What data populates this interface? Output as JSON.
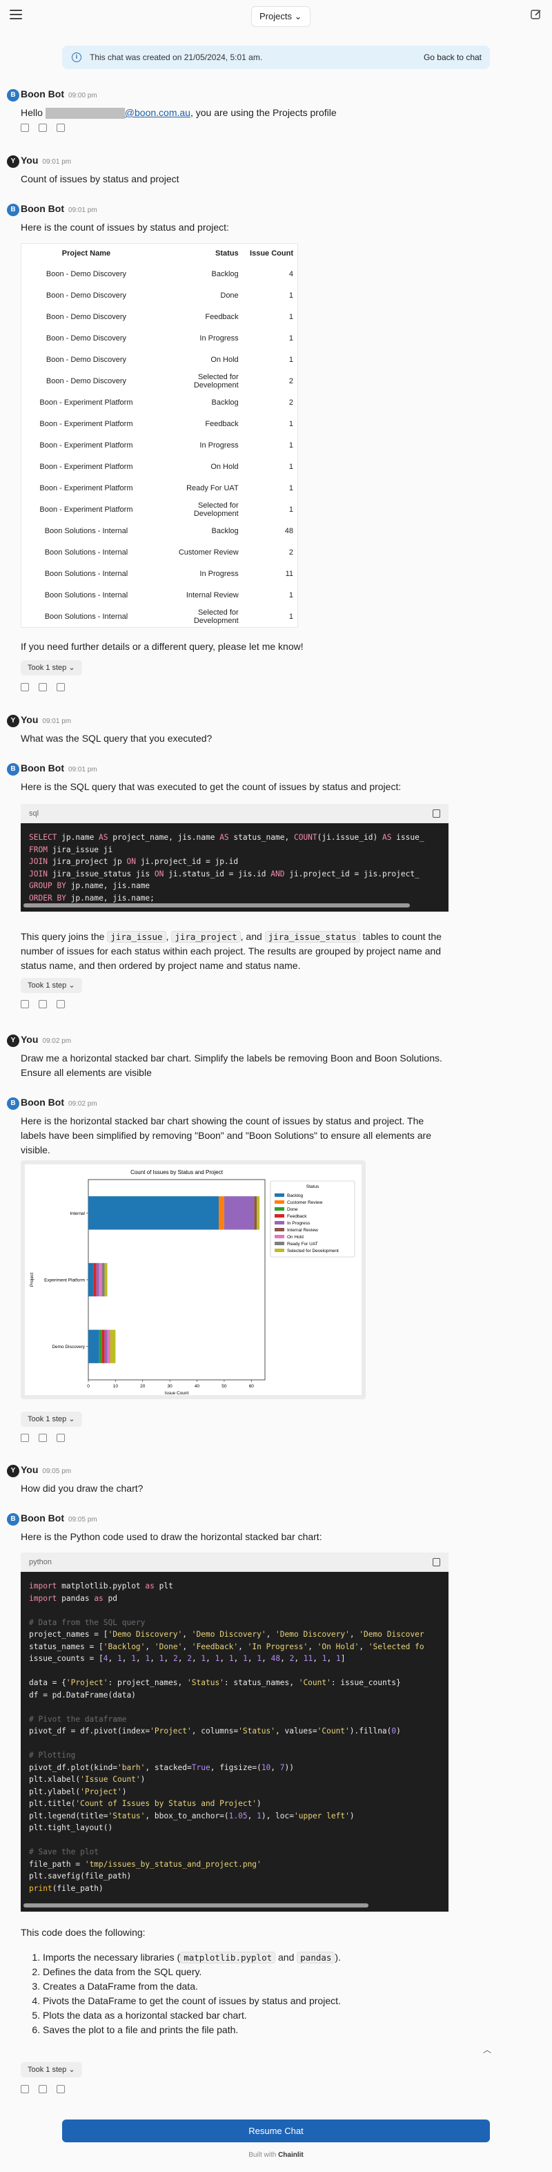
{
  "header": {
    "profile_label": "Projects",
    "profile_chevron": "⌄"
  },
  "banner": {
    "text": "This chat was created on 21/05/2024, 5:01 am.",
    "back": "Go back to chat"
  },
  "bot_name": "Boon Bot",
  "user_name": "You",
  "bot_avatar": "B",
  "user_avatar": "Y",
  "messages": {
    "m1": {
      "time": "09:00 pm",
      "hello": "Hello ",
      "email": "@boon.com.au",
      "tail": ", you are using the Projects profile"
    },
    "m2": {
      "time": "09:01 pm",
      "text": "Count of issues by status and project"
    },
    "m3": {
      "time": "09:01 pm",
      "text": "Here is the count of issues by status and project:",
      "followup": "If you need further details or a different query, please let me know!",
      "step": "Took 1 step"
    },
    "m4": {
      "time": "09:01 pm",
      "text": "What was the SQL query that you executed?"
    },
    "m5": {
      "time": "09:01 pm",
      "text": "Here is the SQL query that was executed to get the count of issues by status and project:",
      "lang": "sql",
      "explain": {
        "p1": "This query joins the ",
        "c1": "jira_issue",
        "p2": ", ",
        "c2": "jira_project",
        "p3": ", and ",
        "c3": "jira_issue_status",
        "p4": " tables to count the number of issues for each status within each project. The results are grouped by project name and status name, and then ordered by project name and status name."
      },
      "step": "Took 1 step"
    },
    "m6": {
      "time": "09:02 pm",
      "text": "Draw me a horizontal stacked bar chart. Simplify the labels be removing Boon and Boon Solutions. Ensure all elements are visible"
    },
    "m7": {
      "time": "09:02 pm",
      "text": "Here is the horizontal stacked bar chart showing the count of issues by status and project. The labels have been simplified by removing \"Boon\" and \"Boon Solutions\" to ensure all elements are visible.",
      "step": "Took 1 step"
    },
    "m8": {
      "time": "09:05 pm",
      "text": "How did you draw the chart?"
    },
    "m9": {
      "time": "09:05 pm",
      "text": "Here is the Python code used to draw the horizontal stacked bar chart:",
      "lang": "python",
      "summary": "This code does the following:",
      "steps_list": {
        "s1a": "Imports the necessary libraries (",
        "s1b": "matplotlib.pyplot",
        "s1c": " and ",
        "s1d": "pandas",
        "s1e": ").",
        "s2": "Defines the data from the SQL query.",
        "s3": "Creates a DataFrame from the data.",
        "s4": "Pivots the DataFrame to get the count of issues by status and project.",
        "s5": "Plots the data as a horizontal stacked bar chart.",
        "s6": "Saves the plot to a file and prints the file path."
      },
      "step": "Took 1 step"
    }
  },
  "issue_table": {
    "headers": [
      "Project Name",
      "Status",
      "Issue Count"
    ],
    "rows": [
      [
        "Boon - Demo Discovery",
        "Backlog",
        "4"
      ],
      [
        "Boon - Demo Discovery",
        "Done",
        "1"
      ],
      [
        "Boon - Demo Discovery",
        "Feedback",
        "1"
      ],
      [
        "Boon - Demo Discovery",
        "In Progress",
        "1"
      ],
      [
        "Boon - Demo Discovery",
        "On Hold",
        "1"
      ],
      [
        "Boon - Demo Discovery",
        "Selected for Development",
        "2"
      ],
      [
        "Boon - Experiment Platform",
        "Backlog",
        "2"
      ],
      [
        "Boon - Experiment Platform",
        "Feedback",
        "1"
      ],
      [
        "Boon - Experiment Platform",
        "In Progress",
        "1"
      ],
      [
        "Boon - Experiment Platform",
        "On Hold",
        "1"
      ],
      [
        "Boon - Experiment Platform",
        "Ready For UAT",
        "1"
      ],
      [
        "Boon - Experiment Platform",
        "Selected for Development",
        "1"
      ],
      [
        "Boon Solutions - Internal",
        "Backlog",
        "48"
      ],
      [
        "Boon Solutions - Internal",
        "Customer Review",
        "2"
      ],
      [
        "Boon Solutions - Internal",
        "In Progress",
        "11"
      ],
      [
        "Boon Solutions - Internal",
        "Internal Review",
        "1"
      ],
      [
        "Boon Solutions - Internal",
        "Selected for Development",
        "1"
      ]
    ]
  },
  "sql_code": "SELECT jp.name AS project_name, jis.name AS status_name, COUNT(ji.issue_id) AS issue_\nFROM jira_issue ji\nJOIN jira_project jp ON ji.project_id = jp.id\nJOIN jira_issue_status jis ON ji.status_id = jis.id AND ji.project_id = jis.project_\nGROUP BY jp.name, jis.name\nORDER BY jp.name, jis.name;",
  "chart_data": {
    "type": "bar",
    "orientation": "horizontal",
    "stacked": true,
    "title": "Count of Issues by Status and Project",
    "xlabel": "Issue Count",
    "ylabel": "Project",
    "xlim": [
      0,
      65
    ],
    "xticks": [
      0,
      10,
      20,
      30,
      40,
      50,
      60
    ],
    "categories": [
      "Demo Discovery",
      "Experiment Platform",
      "Internal"
    ],
    "legend_title": "Status",
    "legend_placement": "upper right, outside plot",
    "series": [
      {
        "name": "Backlog",
        "color": "#1f77b4",
        "values": [
          4,
          2,
          48
        ]
      },
      {
        "name": "Customer Review",
        "color": "#ff7f0e",
        "values": [
          0,
          0,
          2
        ]
      },
      {
        "name": "Done",
        "color": "#2ca02c",
        "values": [
          1,
          0,
          0
        ]
      },
      {
        "name": "Feedback",
        "color": "#d62728",
        "values": [
          1,
          1,
          0
        ]
      },
      {
        "name": "In Progress",
        "color": "#9467bd",
        "values": [
          1,
          1,
          11
        ]
      },
      {
        "name": "Internal Review",
        "color": "#8c564b",
        "values": [
          0,
          0,
          1
        ]
      },
      {
        "name": "On Hold",
        "color": "#e377c2",
        "values": [
          1,
          1,
          0
        ]
      },
      {
        "name": "Ready For UAT",
        "color": "#7f7f7f",
        "values": [
          0,
          1,
          0
        ]
      },
      {
        "name": "Selected for Development",
        "color": "#bcbd22",
        "values": [
          2,
          1,
          1
        ]
      }
    ]
  },
  "footer": {
    "resume": "Resume Chat",
    "built_with": "Built with",
    "brand": "Chainlit"
  }
}
